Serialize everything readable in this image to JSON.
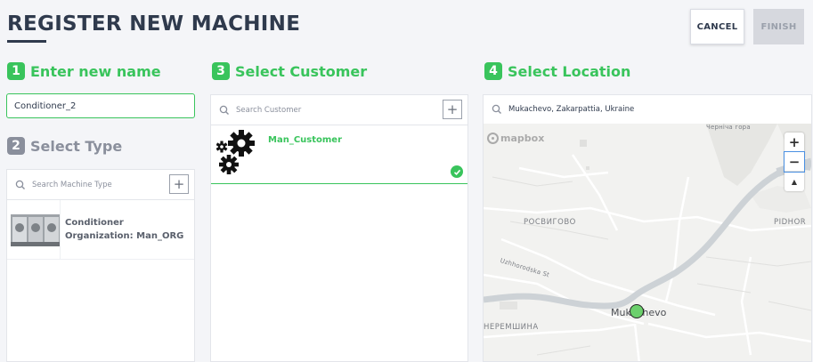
{
  "page": {
    "title": "REGISTER NEW MACHINE",
    "cancel_label": "CANCEL",
    "finish_label": "FINISH"
  },
  "step1": {
    "number": "1",
    "label": "Enter new name",
    "value": "Conditioner_2"
  },
  "step2": {
    "number": "2",
    "label": "Select Type",
    "search_placeholder": "Search Machine Type",
    "add_label": "+",
    "items": [
      {
        "name": "Conditioner",
        "org": "Organization: Man_ORG"
      }
    ]
  },
  "step3": {
    "number": "3",
    "label": "Select Customer",
    "search_placeholder": "Search Customer",
    "add_label": "+",
    "items": [
      {
        "name": "Man_Customer",
        "selected": true
      }
    ]
  },
  "step4": {
    "number": "4",
    "label": "Select Location",
    "search_value": "Mukachevo, Zakarpattia, Ukraine",
    "map": {
      "logo": "mapbox",
      "zoom_in": "+",
      "zoom_out": "−",
      "compass": "▲",
      "labels": {
        "top_right": "Черніча гора",
        "rosvygovo": "РОСВИГОВО",
        "pidhora": "PIDHOR",
        "street": "Uzhhorodska St",
        "city": "Mukachevo",
        "neremshyna": "НЕРЕМШИНА"
      }
    }
  },
  "colors": {
    "accent": "#39c45c",
    "inactive": "#8a8f9c",
    "title": "#2f3a4d",
    "river": "#cdd2d6",
    "background": "#f4f5f8"
  }
}
